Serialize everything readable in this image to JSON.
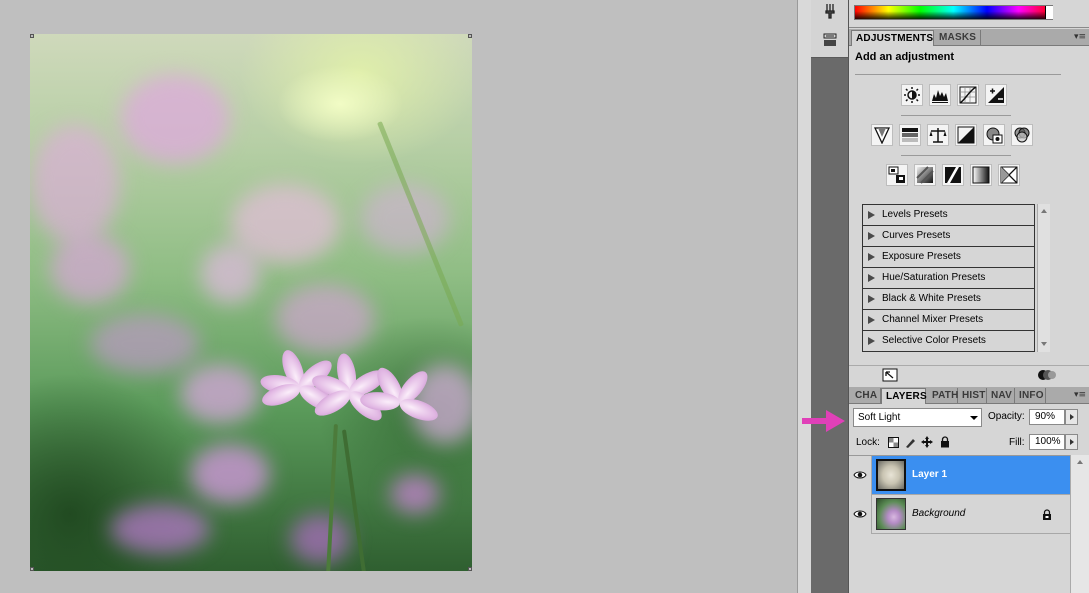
{
  "canvas": {
    "image": "flower-photo"
  },
  "side_icons": [
    "tool-icon",
    "brush-preset-icon"
  ],
  "adjustments_panel": {
    "tabs": [
      {
        "label": "ADJUSTMENTS",
        "active": true
      },
      {
        "label": "MASKS",
        "active": false
      }
    ],
    "title": "Add an adjustment",
    "icon_rows": [
      [
        "brightness-contrast-icon",
        "levels-icon",
        "curves-icon",
        "exposure-icon"
      ],
      [
        "vibrance-icon",
        "hue-saturation-icon",
        "color-balance-icon",
        "black-white-icon",
        "photo-filter-icon",
        "channel-mixer-icon"
      ],
      [
        "invert-icon",
        "posterize-icon",
        "threshold-icon",
        "gradient-map-icon",
        "selective-color-icon"
      ]
    ],
    "presets": [
      "Levels Presets",
      "Curves Presets",
      "Exposure Presets",
      "Hue/Saturation Presets",
      "Black & White Presets",
      "Channel Mixer Presets",
      "Selective Color Presets"
    ]
  },
  "layers_panel": {
    "tabs": [
      {
        "label": "CHA",
        "active": false
      },
      {
        "label": "LAYERS",
        "active": true
      },
      {
        "label": "PATH",
        "active": false
      },
      {
        "label": "HIST",
        "active": false
      },
      {
        "label": "NAV",
        "active": false
      },
      {
        "label": "INFO",
        "active": false
      }
    ],
    "blend_mode": "Soft Light",
    "opacity_label": "Opacity:",
    "opacity_value": "90%",
    "lock_label": "Lock:",
    "fill_label": "Fill:",
    "fill_value": "100%",
    "layers": [
      {
        "name": "Layer 1",
        "selected": true,
        "visible": true,
        "locked": false
      },
      {
        "name": "Background",
        "selected": false,
        "visible": true,
        "locked": true
      }
    ]
  },
  "colors": {
    "selection": "#3b8ff0",
    "annotation_arrow": "#e040b8"
  }
}
